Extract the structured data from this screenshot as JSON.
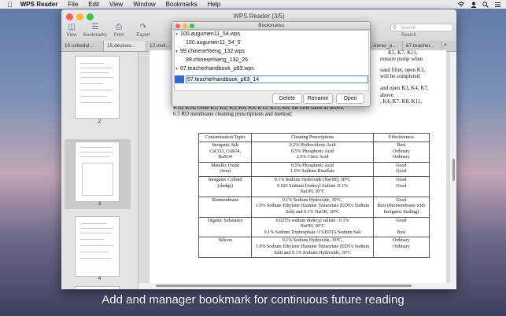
{
  "menubar": {
    "apple": "",
    "app_name": "WPS Reader",
    "items": [
      "File",
      "Edit",
      "View",
      "Window",
      "Bookmarks",
      "Help"
    ]
  },
  "window": {
    "title": "WPS Reader (3/5)",
    "toolbar": [
      {
        "label": "View",
        "icon": "view-icon"
      },
      {
        "label": "Bookmarks",
        "icon": "bookmarks-icon"
      },
      {
        "label": "Print",
        "icon": "print-icon"
      },
      {
        "label": "Export",
        "icon": "export-icon"
      }
    ],
    "search_placeholder": "Search",
    "search_label": "Search",
    "tabs": [
      "10.schedul...",
      "15.devices...",
      "12.invit...",
      "...kores_p...",
      "67.teacher..."
    ],
    "active_tab": 1
  },
  "sidebar": {
    "pages": [
      "2",
      "3",
      "4"
    ],
    "selected_page": "3"
  },
  "document": {
    "lines_right": [
      "K5, K7, K11,",
      "ressure pump when",
      "sand filter, open K3,",
      "will be completed",
      "and open K3, K4, K7,",
      "above.",
      ", K4, K7, K8, K11,"
    ],
    "line_k10": "K10, K14, close K1, K2, K3, K6, K9, K12, K13, K8, the time same as above.",
    "heading": "6.5        RO membrane cleaning prescriptions and method:",
    "table": {
      "headers": [
        "Contamination Types",
        "Cleaning Prescriptions",
        "Effectiveness"
      ],
      "rows": [
        {
          "type": [
            "Inorganic Salt",
            "CaCO3, CaSO4,",
            "BaSO4"
          ],
          "rx": [
            "0.2% Hydrochloric Acid",
            "0.5% Phosphoric Acid",
            "2.0% Citric Acid"
          ],
          "eff": [
            "Best",
            "Ordinary",
            "Ordinary"
          ]
        },
        {
          "type": [
            "Metallic Oxide",
            "(iron)"
          ],
          "rx": [
            "0.5% Phosphoric Acid",
            "1.0% Sodium Bisulfate"
          ],
          "eff": [
            "Good",
            "Good"
          ]
        },
        {
          "type": [
            "Inorganic Colloid",
            "(sludge)"
          ],
          "rx": [
            "0.1% Sodium Hydroxide (NaOH), 30°C",
            "0.025 Sodium Dodecyl Sulfate /0.1%",
            "NaOH, 30°C"
          ],
          "eff": [
            "Good",
            "Good"
          ]
        },
        {
          "type": [
            "Biomembrane"
          ],
          "rx": [
            "0.1% Sodium Hydroxide, 30°C,",
            "1.0% Sodium Ethylene Diamine Tetracetate (EDTA Sodium",
            "Salt) and 0.1% NaOH, 30°C"
          ],
          "eff": [
            "Good",
            "Best (Biomembrane with",
            "Inorganic Scaling)"
          ]
        },
        {
          "type": [
            "Organic Substance"
          ],
          "rx": [
            "0.025% sodium dodecyl sulfate / 0.1%",
            "NaOH, 30°C",
            "0.1% Sodium Triphosphate /1%EDTA Sodium Salt"
          ],
          "eff": [
            "Good",
            "",
            "Best"
          ]
        },
        {
          "type": [
            "Silicon"
          ],
          "rx": [
            "0.1% Sodium Hydroxide, 30°C,",
            "1.0% Sodium Ethylene Diamine Tetracetate (EDTA Sodium",
            "Salt) and 0.1% Sodium Hydroxide, 30°C"
          ],
          "eff": [
            "Ordinary",
            "Ordinary"
          ]
        }
      ]
    }
  },
  "bookmarks_dialog": {
    "title": "Bookmarks",
    "items": [
      {
        "label": "100.augumen11_54.wps",
        "kind": "file"
      },
      {
        "label": "100.augumen11_54_5",
        "kind": "bookmark"
      },
      {
        "label": "99.chinese%eng_132.wps",
        "kind": "file"
      },
      {
        "label": "99.chinese%eng_132_26",
        "kind": "bookmark"
      },
      {
        "label": "67.teacherhandbook_p63.wps",
        "kind": "file"
      }
    ],
    "editing_value": "67.teacherhandbook_p63_14",
    "buttons": {
      "delete": "Delete",
      "rename": "Rename",
      "open": "Open"
    }
  },
  "caption": "Add and manager bookmark for continuous future reading",
  "colors": {
    "accent": "#2f6ad8",
    "close": "#fc5f57",
    "minimize": "#fdbc2e",
    "zoom": "#33c748"
  }
}
